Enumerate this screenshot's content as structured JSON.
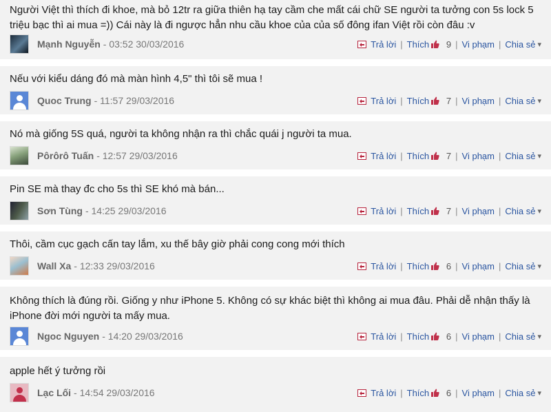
{
  "actions": {
    "reply_label": "Trả lời",
    "like_label": "Thích",
    "report_label": "Vi phạm",
    "share_label": "Chia sẻ",
    "separator": "|"
  },
  "comments": [
    {
      "text": "Người Việt thì thích đi khoe, mà bỏ 12tr ra giữa thiên hạ tay cầm che mất cái chữ SE người ta tưởng con 5s lock 5 triệu bạc thì ai mua =)) Cái này là đi ngược hẳn nhu cầu khoe của của số đông ifan Việt rồi còn đâu :v",
      "author": "Mạnh Nguyễn",
      "datetime": "- 03:52 30/03/2016",
      "likes": "9",
      "avatar": "dark-photo-avatar"
    },
    {
      "text": "Nếu với kiểu dáng đó mà màn hình 4,5\" thì tôi sẽ mua !",
      "author": "Quoc Trung",
      "datetime": "- 11:57 29/03/2016",
      "likes": "7",
      "avatar": "default-person-avatar"
    },
    {
      "text": "Nó mà giống 5S quá, người ta không nhận ra thì chắc quái j người ta mua.",
      "author": "Pôrôrô Tuấn",
      "datetime": "- 12:57 29/03/2016",
      "likes": "7",
      "avatar": "photo-avatar"
    },
    {
      "text": "Pin SE mà thay đc cho 5s thì SE khó mà bán...",
      "author": "Sơn Tùng",
      "datetime": "- 14:25 29/03/2016",
      "likes": "7",
      "avatar": "photo-avatar"
    },
    {
      "text": "Thôi, cầm cục gạch cấn tay lắm, xu thế bây giờ phải cong cong mới thích",
      "author": "Wall Xa",
      "datetime": "- 12:33 29/03/2016",
      "likes": "6",
      "avatar": "photo-avatar"
    },
    {
      "text": "Không thích là đúng rồi. Giống y như iPhone 5. Không có sự khác biệt thì không ai mua đâu. Phải dễ nhận thấy là iPhone đời mới người ta mấy mua.",
      "author": "Ngoc Nguyen",
      "datetime": "- 14:20 29/03/2016",
      "likes": "6",
      "avatar": "default-person-avatar"
    },
    {
      "text": "apple hết ý tưởng rồi",
      "author": "Lạc Lối",
      "datetime": "- 14:54 29/03/2016",
      "likes": "6",
      "avatar": "red-person-avatar"
    }
  ],
  "colors": {
    "background": "#f2f2f2",
    "link": "#2a55a0",
    "like_icon": "#c0304a",
    "reply_icon": "#c0304a"
  }
}
